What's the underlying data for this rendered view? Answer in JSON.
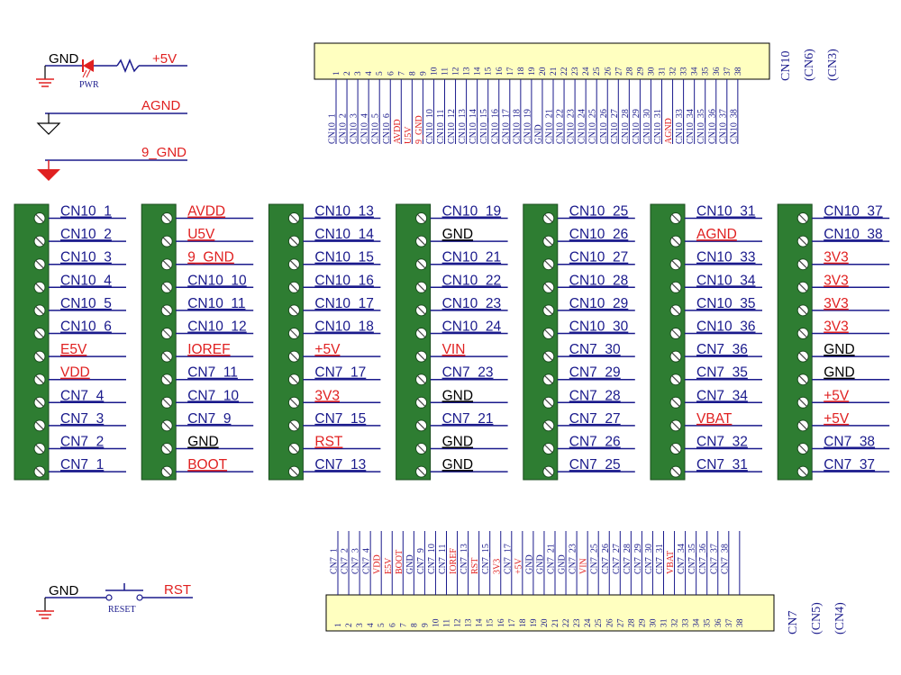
{
  "colors": {
    "wire": "#1a1a8c",
    "red_label": "#e02020",
    "blue_label": "#1a1a8c",
    "block_green": "#2e7d32",
    "header_fill": "#ffffc0"
  },
  "power_symbols": {
    "gnd_label": "GND",
    "vcc_label": "+5V",
    "led_label": "PWR",
    "agnd_label": "AGND",
    "nine_gnd_label": "9_GND"
  },
  "reset_circuit": {
    "gnd_label": "GND",
    "switch_label": "RESET",
    "net_label": "RST"
  },
  "top_header": {
    "name": "CN10",
    "alt_names": [
      "(CN6)",
      "(CN3)"
    ],
    "pins": [
      {
        "num": "1",
        "net": "CN10_1",
        "red": false
      },
      {
        "num": "2",
        "net": "CN10_2",
        "red": false
      },
      {
        "num": "3",
        "net": "CN10_3",
        "red": false
      },
      {
        "num": "4",
        "net": "CN10_4",
        "red": false
      },
      {
        "num": "5",
        "net": "CN10_5",
        "red": false
      },
      {
        "num": "6",
        "net": "CN10_6",
        "red": false
      },
      {
        "num": "7",
        "net": "AVDD",
        "red": true
      },
      {
        "num": "8",
        "net": "U5V",
        "red": true
      },
      {
        "num": "9",
        "net": "9_GND",
        "red": true
      },
      {
        "num": "10",
        "net": "CN10_10",
        "red": false
      },
      {
        "num": "11",
        "net": "CN10_11",
        "red": false
      },
      {
        "num": "12",
        "net": "CN10_12",
        "red": false
      },
      {
        "num": "13",
        "net": "CN10_13",
        "red": false
      },
      {
        "num": "14",
        "net": "CN10_14",
        "red": false
      },
      {
        "num": "15",
        "net": "CN10_15",
        "red": false
      },
      {
        "num": "16",
        "net": "CN10_16",
        "red": false
      },
      {
        "num": "17",
        "net": "CN10_17",
        "red": false
      },
      {
        "num": "18",
        "net": "CN10_18",
        "red": false
      },
      {
        "num": "19",
        "net": "CN10_19",
        "red": false
      },
      {
        "num": "20",
        "net": "GND",
        "red": false
      },
      {
        "num": "21",
        "net": "CN10_21",
        "red": false
      },
      {
        "num": "22",
        "net": "CN10_22",
        "red": false
      },
      {
        "num": "23",
        "net": "CN10_23",
        "red": false
      },
      {
        "num": "24",
        "net": "CN10_24",
        "red": false
      },
      {
        "num": "25",
        "net": "CN10_25",
        "red": false
      },
      {
        "num": "26",
        "net": "CN10_26",
        "red": false
      },
      {
        "num": "27",
        "net": "CN10_27",
        "red": false
      },
      {
        "num": "28",
        "net": "CN10_28",
        "red": false
      },
      {
        "num": "29",
        "net": "CN10_29",
        "red": false
      },
      {
        "num": "30",
        "net": "CN10_30",
        "red": false
      },
      {
        "num": "31",
        "net": "CN10_31",
        "red": false
      },
      {
        "num": "32",
        "net": "AGND",
        "red": true
      },
      {
        "num": "33",
        "net": "CN10_33",
        "red": false
      },
      {
        "num": "34",
        "net": "CN10_34",
        "red": false
      },
      {
        "num": "35",
        "net": "CN10_35",
        "red": false
      },
      {
        "num": "36",
        "net": "CN10_36",
        "red": false
      },
      {
        "num": "37",
        "net": "CN10_37",
        "red": false
      },
      {
        "num": "38",
        "net": "CN10_38",
        "red": false
      }
    ]
  },
  "bottom_header": {
    "name": "CN7",
    "alt_names": [
      "(CN5)",
      "(CN4)"
    ],
    "pins": [
      {
        "num": "1",
        "net": "CN7_1",
        "red": false
      },
      {
        "num": "2",
        "net": "CN7_2",
        "red": false
      },
      {
        "num": "3",
        "net": "CN7_3",
        "red": false
      },
      {
        "num": "4",
        "net": "CN7_4",
        "red": false
      },
      {
        "num": "5",
        "net": "VDD",
        "red": true
      },
      {
        "num": "6",
        "net": "E5V",
        "red": true
      },
      {
        "num": "7",
        "net": "BOOT",
        "red": true
      },
      {
        "num": "8",
        "net": "GND",
        "red": false
      },
      {
        "num": "9",
        "net": "CN7_9",
        "red": false
      },
      {
        "num": "10",
        "net": "CN7_10",
        "red": false
      },
      {
        "num": "11",
        "net": "CN7_11",
        "red": false
      },
      {
        "num": "12",
        "net": "IOREF",
        "red": true
      },
      {
        "num": "13",
        "net": "CN7_13",
        "red": false
      },
      {
        "num": "14",
        "net": "RST",
        "red": true
      },
      {
        "num": "15",
        "net": "CN7_15",
        "red": false
      },
      {
        "num": "16",
        "net": "3V3",
        "red": true
      },
      {
        "num": "17",
        "net": "CN7_17",
        "red": false
      },
      {
        "num": "18",
        "net": "+5V",
        "red": true
      },
      {
        "num": "19",
        "net": "GND",
        "red": false
      },
      {
        "num": "20",
        "net": "GND",
        "red": false
      },
      {
        "num": "21",
        "net": "CN7_21",
        "red": false
      },
      {
        "num": "22",
        "net": "GND",
        "red": false
      },
      {
        "num": "23",
        "net": "CN7_23",
        "red": false
      },
      {
        "num": "24",
        "net": "VIN",
        "red": true
      },
      {
        "num": "25",
        "net": "CN7_25",
        "red": false
      },
      {
        "num": "26",
        "net": "CN7_26",
        "red": false
      },
      {
        "num": "27",
        "net": "CN7_27",
        "red": false
      },
      {
        "num": "28",
        "net": "CN7_28",
        "red": false
      },
      {
        "num": "29",
        "net": "CN7_29",
        "red": false
      },
      {
        "num": "30",
        "net": "CN7_30",
        "red": false
      },
      {
        "num": "31",
        "net": "CN7_31",
        "red": false
      },
      {
        "num": "32",
        "net": "VBAT",
        "red": true
      },
      {
        "num": "33",
        "net": "CN7_34",
        "red": false
      },
      {
        "num": "34",
        "net": "CN7_35",
        "red": false
      },
      {
        "num": "35",
        "net": "CN7_36",
        "red": false
      },
      {
        "num": "36",
        "net": "CN7_37",
        "red": false
      },
      {
        "num": "37",
        "net": "CN7_38",
        "red": false
      },
      {
        "num": "38",
        "net": "",
        "red": false
      }
    ]
  },
  "terminal_blocks": [
    [
      {
        "label": "CN10_1",
        "red": false
      },
      {
        "label": "CN10_2",
        "red": false
      },
      {
        "label": "CN10_3",
        "red": false
      },
      {
        "label": "CN10_4",
        "red": false
      },
      {
        "label": "CN10_5",
        "red": false
      },
      {
        "label": "CN10_6",
        "red": false
      },
      {
        "label": "E5V",
        "red": true
      },
      {
        "label": "VDD",
        "red": true
      },
      {
        "label": "CN7_4",
        "red": false
      },
      {
        "label": "CN7_3",
        "red": false
      },
      {
        "label": "CN7_2",
        "red": false
      },
      {
        "label": "CN7_1",
        "red": false
      }
    ],
    [
      {
        "label": "AVDD",
        "red": true
      },
      {
        "label": "U5V",
        "red": true
      },
      {
        "label": "9_GND",
        "red": true
      },
      {
        "label": "CN10_10",
        "red": false
      },
      {
        "label": "CN10_11",
        "red": false
      },
      {
        "label": "CN10_12",
        "red": false
      },
      {
        "label": "IOREF",
        "red": true
      },
      {
        "label": "CN7_11",
        "red": false
      },
      {
        "label": "CN7_10",
        "red": false
      },
      {
        "label": "CN7_9",
        "red": false
      },
      {
        "label": "GND",
        "red": false
      },
      {
        "label": "BOOT",
        "red": true
      }
    ],
    [
      {
        "label": "CN10_13",
        "red": false
      },
      {
        "label": "CN10_14",
        "red": false
      },
      {
        "label": "CN10_15",
        "red": false
      },
      {
        "label": "CN10_16",
        "red": false
      },
      {
        "label": "CN10_17",
        "red": false
      },
      {
        "label": "CN10_18",
        "red": false
      },
      {
        "label": "+5V",
        "red": true
      },
      {
        "label": "CN7_17",
        "red": false
      },
      {
        "label": "3V3",
        "red": true
      },
      {
        "label": "CN7_15",
        "red": false
      },
      {
        "label": "RST",
        "red": true
      },
      {
        "label": "CN7_13",
        "red": false
      }
    ],
    [
      {
        "label": "CN10_19",
        "red": false
      },
      {
        "label": "GND",
        "red": false
      },
      {
        "label": "CN10_21",
        "red": false
      },
      {
        "label": "CN10_22",
        "red": false
      },
      {
        "label": "CN10_23",
        "red": false
      },
      {
        "label": "CN10_24",
        "red": false
      },
      {
        "label": "VIN",
        "red": true
      },
      {
        "label": "CN7_23",
        "red": false
      },
      {
        "label": "GND",
        "red": false
      },
      {
        "label": "CN7_21",
        "red": false
      },
      {
        "label": "GND",
        "red": false
      },
      {
        "label": "GND",
        "red": false
      }
    ],
    [
      {
        "label": "CN10_25",
        "red": false
      },
      {
        "label": "CN10_26",
        "red": false
      },
      {
        "label": "CN10_27",
        "red": false
      },
      {
        "label": "CN10_28",
        "red": false
      },
      {
        "label": "CN10_29",
        "red": false
      },
      {
        "label": "CN10_30",
        "red": false
      },
      {
        "label": "CN7_30",
        "red": false
      },
      {
        "label": "CN7_29",
        "red": false
      },
      {
        "label": "CN7_28",
        "red": false
      },
      {
        "label": "CN7_27",
        "red": false
      },
      {
        "label": "CN7_26",
        "red": false
      },
      {
        "label": "CN7_25",
        "red": false
      }
    ],
    [
      {
        "label": "CN10_31",
        "red": false
      },
      {
        "label": "AGND",
        "red": true
      },
      {
        "label": "CN10_33",
        "red": false
      },
      {
        "label": "CN10_34",
        "red": false
      },
      {
        "label": "CN10_35",
        "red": false
      },
      {
        "label": "CN10_36",
        "red": false
      },
      {
        "label": "CN7_36",
        "red": false
      },
      {
        "label": "CN7_35",
        "red": false
      },
      {
        "label": "CN7_34",
        "red": false
      },
      {
        "label": "VBAT",
        "red": true
      },
      {
        "label": "CN7_32",
        "red": false
      },
      {
        "label": "CN7_31",
        "red": false
      }
    ],
    [
      {
        "label": "CN10_37",
        "red": false
      },
      {
        "label": "CN10_38",
        "red": false
      },
      {
        "label": "3V3",
        "red": true
      },
      {
        "label": "3V3",
        "red": true
      },
      {
        "label": "3V3",
        "red": true
      },
      {
        "label": "3V3",
        "red": true
      },
      {
        "label": "GND",
        "red": false
      },
      {
        "label": "GND",
        "red": false
      },
      {
        "label": "+5V",
        "red": true
      },
      {
        "label": "+5V",
        "red": true
      },
      {
        "label": "CN7_38",
        "red": false
      },
      {
        "label": "CN7_37",
        "red": false
      }
    ]
  ]
}
